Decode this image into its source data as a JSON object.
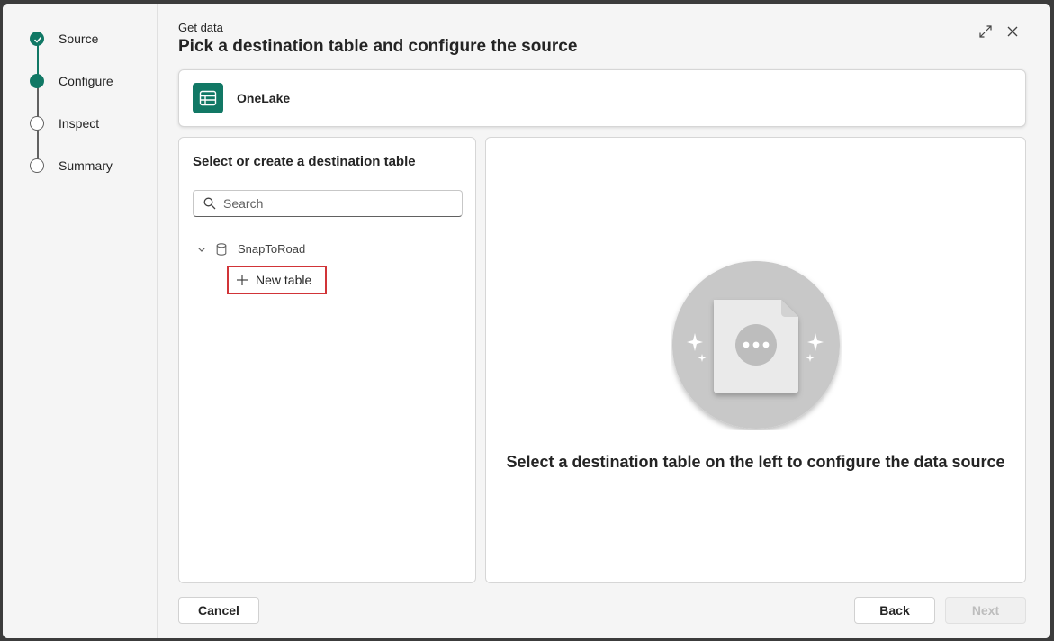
{
  "stepper": {
    "steps": [
      {
        "label": "Source",
        "state": "done"
      },
      {
        "label": "Configure",
        "state": "active"
      },
      {
        "label": "Inspect",
        "state": "pending"
      },
      {
        "label": "Summary",
        "state": "pending"
      }
    ]
  },
  "header": {
    "subtitle": "Get data",
    "title": "Pick a destination table and configure the source",
    "icons": [
      "expand-icon",
      "close-icon"
    ]
  },
  "source": {
    "name": "OneLake",
    "icon": "onelake-table-icon"
  },
  "destination": {
    "title": "Select or create a destination table",
    "search_placeholder": "Search",
    "database": {
      "name": "SnapToRoad",
      "icon": "database-icon",
      "expanded": true
    },
    "new_table_label": "New table"
  },
  "preview": {
    "empty_message": "Select a destination table on the left to configure the data source",
    "illustration": "file-placeholder-icon"
  },
  "footer": {
    "cancel_label": "Cancel",
    "back_label": "Back",
    "next_label": "Next"
  },
  "colors": {
    "accent": "#117865",
    "highlight_border": "#d13438"
  }
}
